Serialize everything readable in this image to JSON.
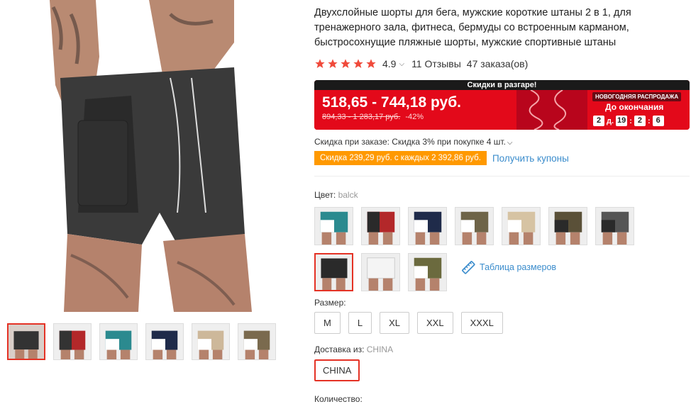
{
  "product": {
    "title": "Двухслойные шорты для бега, мужские короткие штаны 2 в 1, для тренажерного зала, фитнеса, бермуды со встроенным карманом, быстросохнущие пляжные шорты, мужские спортивные штаны",
    "rating": "4.9",
    "reviews": "11 Отзывы",
    "orders": "47 заказа(ов)",
    "star_color": "#f04a3b"
  },
  "promo": {
    "banner_title": "Скидки в разгаре!",
    "price_range": "518,65 - 744,18 руб.",
    "old_price": "894,33 - 1 283,17 руб.",
    "discount": "-42%",
    "event_badge": "НОВОГОДНЯЯ РАСПРОДАЖА",
    "ends_label": "До окончания",
    "timer": {
      "days": "2",
      "days_label": "д.",
      "hours": "19",
      "minutes": "2",
      "seconds": "6"
    },
    "accent_color": "#e3091a"
  },
  "discount_line": "Скидка при заказе: Скидка 3% при покупке 4 шт.",
  "coupon": {
    "text": "Скидка 239,29 руб. с каждых 2 392,86 руб.",
    "link": "Получить купоны"
  },
  "color": {
    "label": "Цвет:",
    "selected": "balck",
    "swatches": [
      "teal",
      "red",
      "navy",
      "camo",
      "khaki",
      "camo-dark",
      "grey",
      "black",
      "white",
      "army-green"
    ]
  },
  "size_chart_link": "Таблица размеров",
  "size": {
    "label": "Размер:",
    "options": [
      "M",
      "L",
      "XL",
      "XXL",
      "XXXL"
    ]
  },
  "shipping": {
    "label": "Доставка из:",
    "selected": "CHINA",
    "option": "CHINA"
  },
  "quantity": {
    "label": "Количество:"
  }
}
